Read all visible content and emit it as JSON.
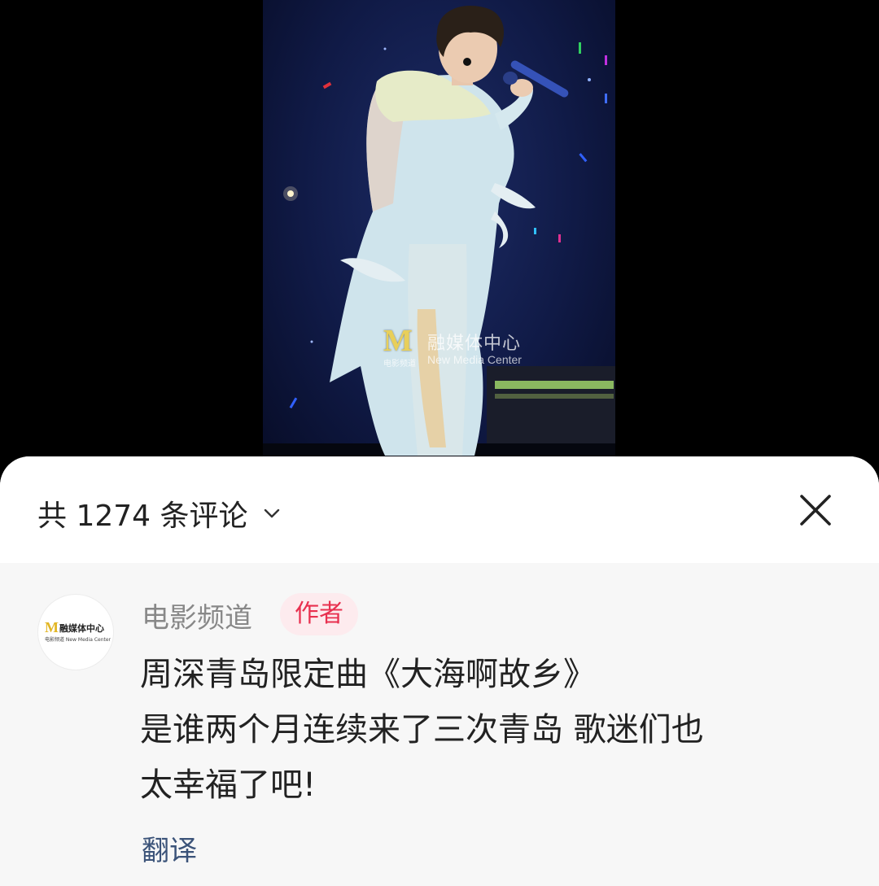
{
  "video": {
    "watermark_logo": "M",
    "watermark_title": "融媒体中心",
    "watermark_en": "New Media Center",
    "watermark_sub": "电影频道"
  },
  "comments_header": {
    "count_label": "共 1274 条评论",
    "expand_icon": "chevron-down-icon",
    "close_icon": "close-icon"
  },
  "comment": {
    "avatar": {
      "logo": "M",
      "title": "融媒体中心",
      "subtitle": "电影频道  New Media Center"
    },
    "author_name": "电影频道",
    "author_badge": "作者",
    "text_lines": [
      "周深青岛限定曲《大海啊故乡》",
      "是谁两个月连续来了三次青岛 歌迷们也",
      "太幸福了吧!"
    ],
    "translate_label": "翻译"
  },
  "colors": {
    "badge_bg": "#fdebee",
    "badge_text": "#e8304f",
    "translate_link": "#3b5379",
    "comment_bg": "#f7f7f7"
  }
}
